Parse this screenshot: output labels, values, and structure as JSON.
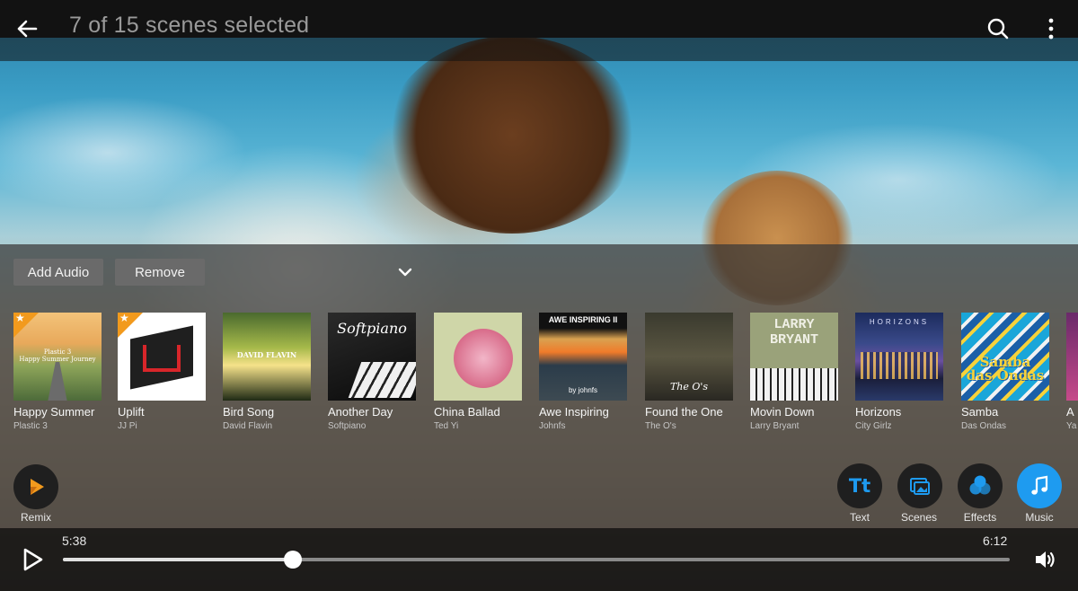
{
  "header": {
    "title": "7 of 15 scenes selected"
  },
  "audio_panel": {
    "add_audio_label": "Add Audio",
    "remove_label": "Remove"
  },
  "tracks": [
    {
      "title": "Happy Summer",
      "artist": "Plastic 3",
      "starred": true,
      "cover_text": "Plastic 3\nHappy Summer Journey"
    },
    {
      "title": "Uplift",
      "artist": "JJ Pi",
      "starred": true,
      "cover_text": ""
    },
    {
      "title": "Bird Song",
      "artist": "David Flavin",
      "starred": false,
      "cover_text": "DAVID FLAVIN"
    },
    {
      "title": "Another Day",
      "artist": "Softpiano",
      "starred": false,
      "cover_text": "Softpiano"
    },
    {
      "title": "China Ballad",
      "artist": "Ted Yi",
      "starred": false,
      "cover_text": ""
    },
    {
      "title": "Awe Inspiring",
      "artist": "Johnfs",
      "starred": false,
      "cover_text": "AWE INSPIRING II",
      "cover_sub": "by johnfs"
    },
    {
      "title": "Found the One",
      "artist": "The O's",
      "starred": false,
      "cover_text": "The O's"
    },
    {
      "title": "Movin Down",
      "artist": "Larry Bryant",
      "starred": false,
      "cover_text": "LARRY BRYANT"
    },
    {
      "title": "Horizons",
      "artist": "City Girlz",
      "starred": false,
      "cover_text": "HORIZONS"
    },
    {
      "title": "Samba",
      "artist": "Das Ondas",
      "starred": false,
      "cover_text": "Samba das Ondas"
    },
    {
      "title": "A",
      "artist": "Ya",
      "starred": false,
      "cover_text": ""
    }
  ],
  "tools": {
    "remix_label": "Remix",
    "text_label": "Text",
    "scenes_label": "Scenes",
    "effects_label": "Effects",
    "music_label": "Music"
  },
  "player": {
    "current_time": "5:38",
    "total_time": "6:12",
    "progress": 0.243
  },
  "colors": {
    "accent": "#1e9bf0",
    "star": "#f29a1d",
    "remix_icon": "#f29a1d"
  },
  "icons": {
    "back": "arrow-left",
    "search": "magnifier",
    "more": "vertical-ellipsis",
    "collapse": "chevron-down",
    "play": "triangle",
    "volume": "speaker"
  }
}
